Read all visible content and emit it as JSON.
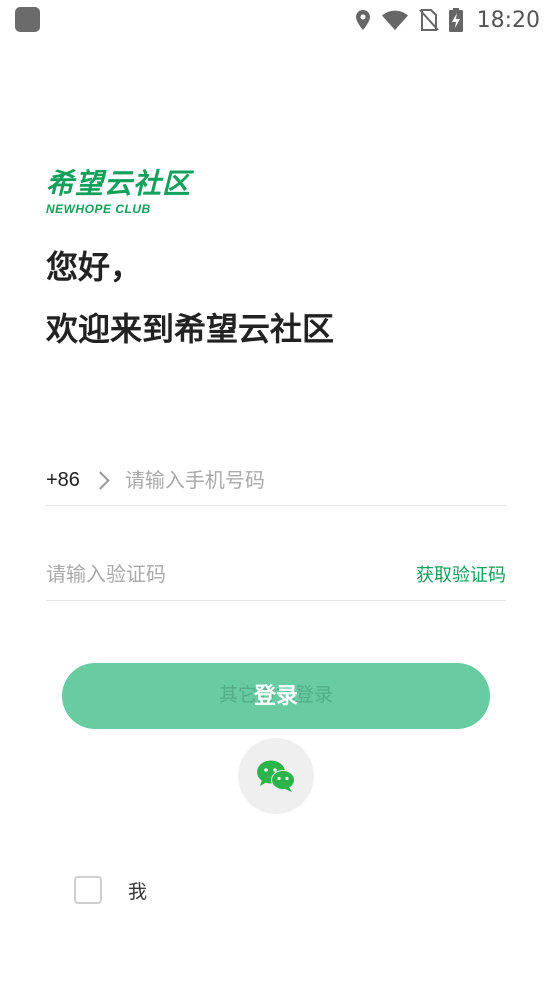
{
  "status_bar": {
    "time": "18:20",
    "icons": [
      "location-icon",
      "wifi-icon",
      "no-sim-icon",
      "battery-charging-icon"
    ]
  },
  "logo": {
    "name_cn": "希望云社区",
    "name_en": "NEWHOPE CLUB"
  },
  "greeting": {
    "line1": "您好，",
    "line2": "欢迎来到希望云社区"
  },
  "phone_field": {
    "country_code": "+86",
    "placeholder": "请输入手机号码",
    "value": ""
  },
  "code_field": {
    "placeholder": "请输入验证码",
    "value": "",
    "get_code_label": "获取验证码"
  },
  "login_button": {
    "label": "登录",
    "other_login_label": "其它方式登录"
  },
  "wechat": {
    "icon": "wechat-icon"
  },
  "agreement": {
    "checked": false,
    "text": "我"
  },
  "colors": {
    "brand_green": "#12a05a",
    "button_green": "#68cba2",
    "background": "#ffffff"
  }
}
